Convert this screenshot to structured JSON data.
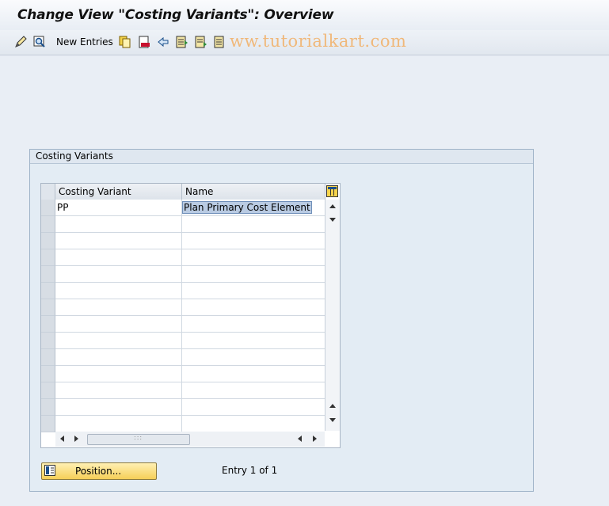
{
  "window": {
    "title": "Change View \"Costing Variants\": Overview"
  },
  "toolbar": {
    "new_entries_label": "New Entries",
    "watermark": "ww.tutorialkart.com",
    "icons": [
      "display-change-icon",
      "find-icon",
      "copy-icon",
      "delete-icon",
      "undo-icon",
      "select-all-icon",
      "select-block-icon",
      "deselect-all-icon"
    ]
  },
  "group": {
    "title": "Costing Variants",
    "table": {
      "columns": [
        "Costing Variant",
        "Name"
      ],
      "rows": [
        [
          "PP",
          "Plan Primary Cost Element"
        ],
        [
          "",
          ""
        ],
        [
          "",
          ""
        ],
        [
          "",
          ""
        ],
        [
          "",
          ""
        ],
        [
          "",
          ""
        ],
        [
          "",
          ""
        ],
        [
          "",
          ""
        ],
        [
          "",
          ""
        ],
        [
          "",
          ""
        ],
        [
          "",
          ""
        ],
        [
          "",
          ""
        ],
        [
          "",
          ""
        ],
        [
          "",
          ""
        ]
      ]
    },
    "position_button_label": "Position...",
    "entry_info": "Entry 1 of 1"
  },
  "colors": {
    "button_accent": "#f6cf58",
    "selection": "#b9cbe3",
    "watermark": "#f0b87a"
  }
}
